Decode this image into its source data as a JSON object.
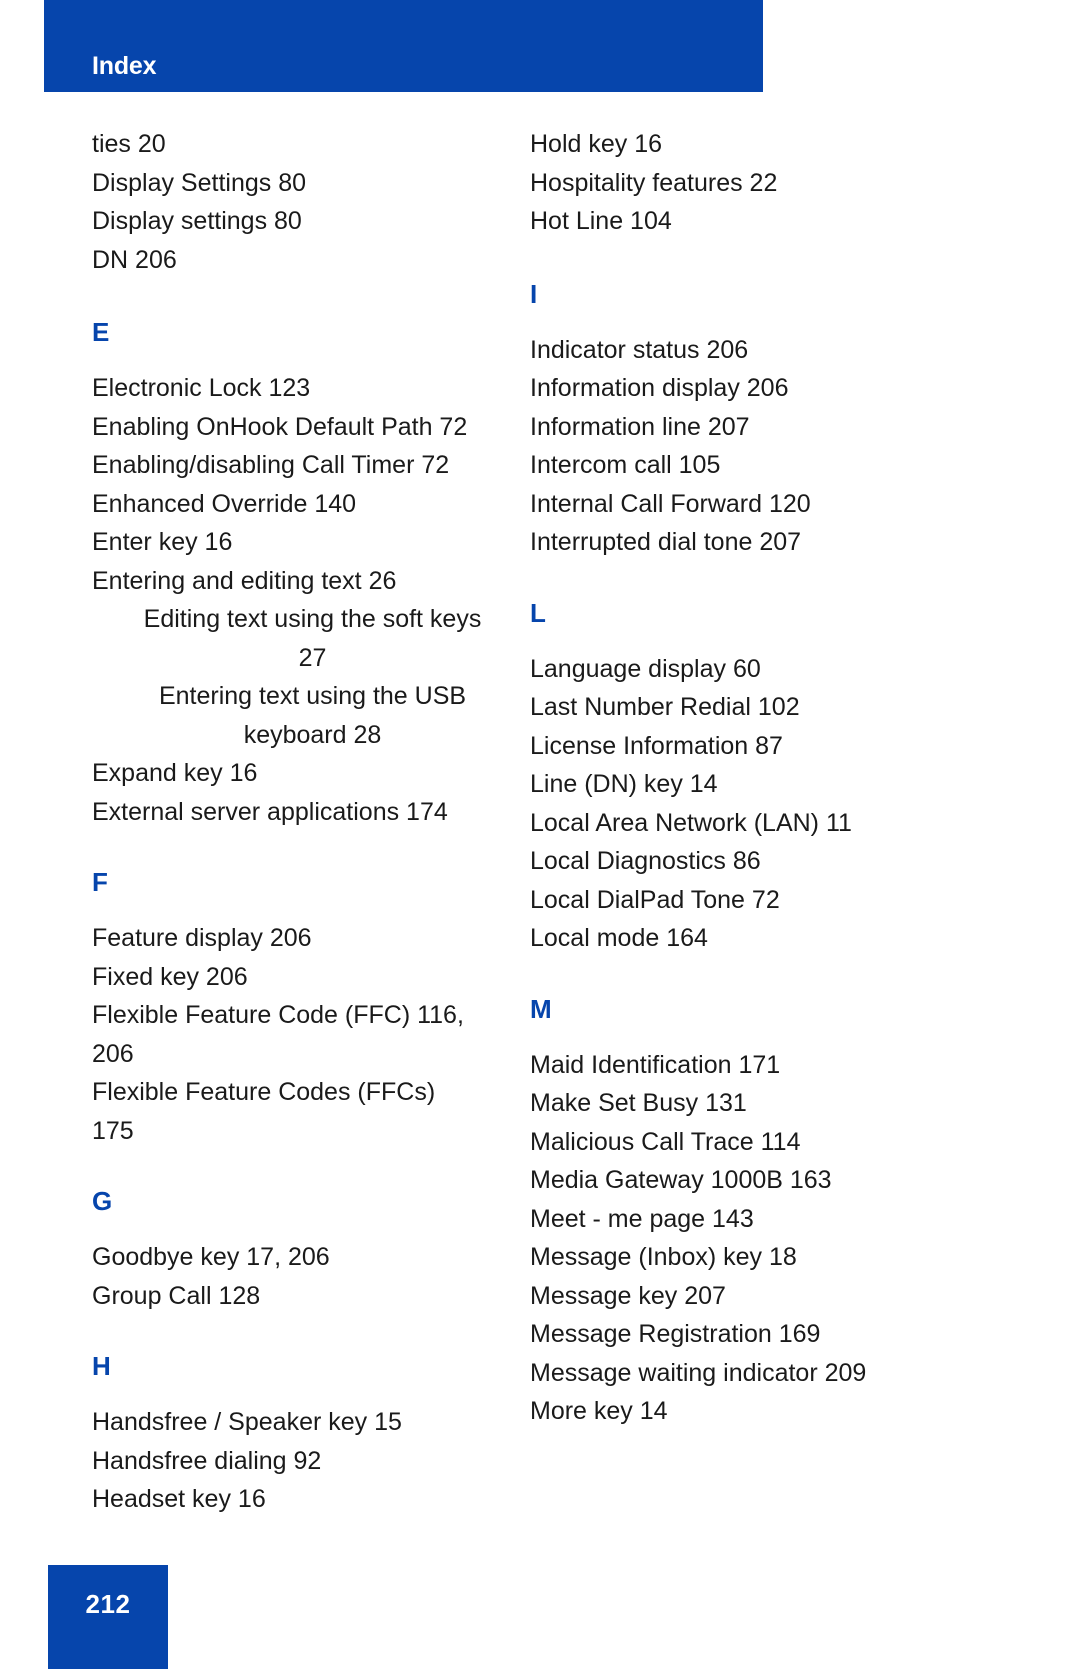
{
  "header": {
    "title": "Index",
    "band_color": "#0645AC"
  },
  "footer": {
    "page_number": "212",
    "box_color": "#0645AC"
  },
  "columns": {
    "left": {
      "continued_entries": [
        "ties 20",
        "Display Settings 80",
        "Display settings 80",
        "DN 206"
      ],
      "sections": [
        {
          "letter": "E",
          "entries": [
            {
              "text": "Electronic Lock 123",
              "level": 1
            },
            {
              "text": "Enabling OnHook Default Path 72",
              "level": 1
            },
            {
              "text": "Enabling/disabling Call Timer 72",
              "level": 1
            },
            {
              "text": "Enhanced Override 140",
              "level": 1
            },
            {
              "text": "Enter key 16",
              "level": 1
            },
            {
              "text": "Entering and editing text 26",
              "level": 1
            },
            {
              "text": "Editing text using the soft keys",
              "cont": "27",
              "level": 2
            },
            {
              "text": "Entering  text  using  the  USB",
              "cont": "keyboard 28",
              "level": 2
            },
            {
              "text": "Expand key 16",
              "level": 1
            },
            {
              "text": "External server applications 174",
              "level": 1
            }
          ]
        },
        {
          "letter": "F",
          "entries": [
            {
              "text": "Feature display 206",
              "level": 1
            },
            {
              "text": "Fixed key 206",
              "level": 1
            },
            {
              "text": "Flexible Feature Code (FFC) 116, 206",
              "level": 1,
              "wrap": true
            },
            {
              "text": "Flexible Feature Codes (FFCs) 175",
              "level": 1,
              "wrap": true
            }
          ]
        },
        {
          "letter": "G",
          "entries": [
            {
              "text": "Goodbye key 17, 206",
              "level": 1
            },
            {
              "text": "Group Call 128",
              "level": 1
            }
          ]
        },
        {
          "letter": "H",
          "entries": [
            {
              "text": "Handsfree / Speaker key 15",
              "level": 1
            },
            {
              "text": "Handsfree dialing 92",
              "level": 1
            },
            {
              "text": "Headset key 16",
              "level": 1
            }
          ]
        }
      ]
    },
    "right": {
      "continued_entries": [
        "Hold key 16",
        "Hospitality features 22",
        "Hot Line 104"
      ],
      "sections": [
        {
          "letter": "I",
          "entries": [
            {
              "text": "Indicator status 206",
              "level": 1
            },
            {
              "text": "Information display 206",
              "level": 1
            },
            {
              "text": "Information line 207",
              "level": 1
            },
            {
              "text": "Intercom call 105",
              "level": 1
            },
            {
              "text": "Internal Call Forward 120",
              "level": 1
            },
            {
              "text": "Interrupted dial tone 207",
              "level": 1
            }
          ]
        },
        {
          "letter": "L",
          "entries": [
            {
              "text": "Language display 60",
              "level": 1
            },
            {
              "text": "Last Number Redial 102",
              "level": 1
            },
            {
              "text": "License Information 87",
              "level": 1
            },
            {
              "text": "Line (DN) key 14",
              "level": 1
            },
            {
              "text": "Local Area Network (LAN) 11",
              "level": 1
            },
            {
              "text": "Local Diagnostics 86",
              "level": 1
            },
            {
              "text": "Local DialPad Tone 72",
              "level": 1
            },
            {
              "text": "Local mode 164",
              "level": 1
            }
          ]
        },
        {
          "letter": "M",
          "entries": [
            {
              "text": "Maid Identification 171",
              "level": 1
            },
            {
              "text": "Make Set Busy 131",
              "level": 1
            },
            {
              "text": "Malicious Call Trace 114",
              "level": 1
            },
            {
              "text": "Media Gateway 1000B 163",
              "level": 1
            },
            {
              "text": "Meet - me page 143",
              "level": 1
            },
            {
              "text": "Message (Inbox) key 18",
              "level": 1
            },
            {
              "text": "Message key 207",
              "level": 1
            },
            {
              "text": "Message Registration 169",
              "level": 1
            },
            {
              "text": "Message waiting indicator 209",
              "level": 1
            },
            {
              "text": "More key 14",
              "level": 1
            }
          ]
        }
      ]
    }
  }
}
